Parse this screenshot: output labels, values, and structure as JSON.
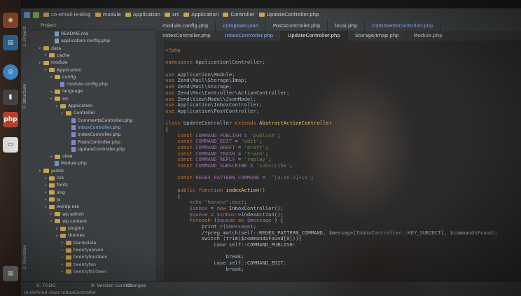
{
  "topbar": {
    "crumbs": [
      "co-email-ie-Blog",
      "module",
      "Application",
      "src",
      "Application",
      "Controller",
      "UpdateController.php"
    ]
  },
  "sidebar_tabs": [
    "1: Project",
    "7: Structure",
    "2: Favorites"
  ],
  "project": {
    "header": "Project",
    "tree": [
      {
        "label": "README.md",
        "indent": 3,
        "kind": "file"
      },
      {
        "label": "application.config.php",
        "indent": 3,
        "kind": "file"
      },
      {
        "label": "data",
        "indent": 1,
        "kind": "folder"
      },
      {
        "label": "cache",
        "indent": 2,
        "kind": "folder"
      },
      {
        "label": "module",
        "indent": 1,
        "kind": "folder"
      },
      {
        "label": "Application",
        "indent": 2,
        "kind": "folder"
      },
      {
        "label": "config",
        "indent": 3,
        "kind": "folder"
      },
      {
        "label": "module.config.php",
        "indent": 4,
        "kind": "php"
      },
      {
        "label": "language",
        "indent": 3,
        "kind": "folder"
      },
      {
        "label": "src",
        "indent": 3,
        "kind": "folder"
      },
      {
        "label": "Application",
        "indent": 4,
        "kind": "folder"
      },
      {
        "label": "Controller",
        "indent": 5,
        "kind": "folder"
      },
      {
        "label": "CommentsController.php",
        "indent": 6,
        "kind": "php"
      },
      {
        "label": "InboxController.php",
        "indent": 6,
        "kind": "php",
        "blue": true
      },
      {
        "label": "IndexController.php",
        "indent": 6,
        "kind": "php"
      },
      {
        "label": "PostsController.php",
        "indent": 6,
        "kind": "php"
      },
      {
        "label": "UpdateController.php",
        "indent": 6,
        "kind": "php"
      },
      {
        "label": "view",
        "indent": 3,
        "kind": "folder"
      },
      {
        "label": "Module.php",
        "indent": 3,
        "kind": "php"
      },
      {
        "label": "public",
        "indent": 1,
        "kind": "folder"
      },
      {
        "label": "css",
        "indent": 2,
        "kind": "folder"
      },
      {
        "label": "fonts",
        "indent": 2,
        "kind": "folder"
      },
      {
        "label": "img",
        "indent": 2,
        "kind": "folder"
      },
      {
        "label": "js",
        "indent": 2,
        "kind": "folder"
      },
      {
        "label": "wordp ess",
        "indent": 2,
        "kind": "folder"
      },
      {
        "label": "wp admin",
        "indent": 3,
        "kind": "folder"
      },
      {
        "label": "wp content",
        "indent": 3,
        "kind": "folder"
      },
      {
        "label": "plugins",
        "indent": 4,
        "kind": "folder"
      },
      {
        "label": "themes",
        "indent": 4,
        "kind": "folder"
      },
      {
        "label": "blankslate",
        "indent": 5,
        "kind": "folder"
      },
      {
        "label": "twentyeleven",
        "indent": 5,
        "kind": "folder"
      },
      {
        "label": "twentyfourteen",
        "indent": 5,
        "kind": "folder"
      },
      {
        "label": "twentyten",
        "indent": 5,
        "kind": "folder"
      },
      {
        "label": "twentythirteen",
        "indent": 5,
        "kind": "folder"
      }
    ]
  },
  "tabs_row1": [
    {
      "label": "module.config.php",
      "state": ""
    },
    {
      "label": "composer.json",
      "state": "blue"
    },
    {
      "label": "PostsController.php",
      "state": ""
    },
    {
      "label": "local.php",
      "state": ""
    },
    {
      "label": "CommentsController.php",
      "state": "blue"
    }
  ],
  "tabs_row2": [
    {
      "label": "IndexController.php",
      "state": ""
    },
    {
      "label": "InboxController.php",
      "state": "blue"
    },
    {
      "label": "UpdateController.php",
      "state": "active"
    },
    {
      "label": "Storage/Imap.php",
      "state": ""
    },
    {
      "label": "Module.php",
      "state": ""
    }
  ],
  "editor": {
    "lines": [
      [
        [
          "kw",
          "<?php"
        ]
      ],
      [
        [
          "",
          ""
        ]
      ],
      [
        [
          "kw",
          "namespace "
        ],
        [
          "",
          "Application\\Controller;"
        ]
      ],
      [
        [
          "",
          ""
        ]
      ],
      [
        [
          "kw",
          "use "
        ],
        [
          "",
          "Application\\Module;"
        ]
      ],
      [
        [
          "kw",
          "use "
        ],
        [
          "",
          "Zend\\Mail\\Storage\\Imap;"
        ]
      ],
      [
        [
          "kw",
          "use "
        ],
        [
          "",
          "Zend\\Mail\\Storage;"
        ]
      ],
      [
        [
          "kw",
          "use "
        ],
        [
          "",
          "Zend\\Mvc\\Controller\\ActionController;"
        ]
      ],
      [
        [
          "kw",
          "use "
        ],
        [
          "",
          "Zend\\View\\Model\\JsonModel;"
        ]
      ],
      [
        [
          "kw",
          "use "
        ],
        [
          "",
          "Application\\InboxController;"
        ]
      ],
      [
        [
          "kw",
          "use "
        ],
        [
          "",
          "Application\\PostController;"
        ]
      ],
      [
        [
          "",
          ""
        ]
      ],
      [
        [
          "kw",
          "class "
        ],
        [
          "",
          "UpdateController "
        ],
        [
          "kw",
          "extends "
        ],
        [
          "cls",
          "AbstractActionController"
        ]
      ],
      [
        [
          "",
          "{"
        ]
      ],
      [
        [
          "kw",
          "    const "
        ],
        [
          "var",
          "COMMAND_PUBLISH"
        ],
        [
          "",
          " = "
        ],
        [
          "str",
          "'publish'"
        ],
        [
          "",
          ";"
        ]
      ],
      [
        [
          "kw",
          "    const "
        ],
        [
          "var",
          "COMMAND_EDIT"
        ],
        [
          "",
          " = "
        ],
        [
          "str",
          "'edit'"
        ],
        [
          "",
          ";"
        ]
      ],
      [
        [
          "kw",
          "    const "
        ],
        [
          "var",
          "COMMAND_DRAFT"
        ],
        [
          "",
          " = "
        ],
        [
          "str",
          "'draft'"
        ],
        [
          "",
          ";"
        ]
      ],
      [
        [
          "kw",
          "    const "
        ],
        [
          "var",
          "COMMAND_TRASH"
        ],
        [
          "",
          " = "
        ],
        [
          "str",
          "'trash'"
        ],
        [
          "",
          ";"
        ]
      ],
      [
        [
          "kw",
          "    const "
        ],
        [
          "var",
          "COMMAND_REPLY"
        ],
        [
          "",
          " = "
        ],
        [
          "str",
          "'replay'"
        ],
        [
          "",
          ";"
        ]
      ],
      [
        [
          "kw",
          "    const "
        ],
        [
          "var",
          "COMMAND_SUBSCRIBE"
        ],
        [
          "",
          " = "
        ],
        [
          "str",
          "'subscribe'"
        ],
        [
          "",
          ";"
        ]
      ],
      [
        [
          "",
          ""
        ]
      ],
      [
        [
          "kw",
          "    const "
        ],
        [
          "var",
          "REGEX_PATTERN_COMMAND"
        ],
        [
          "",
          " = "
        ],
        [
          "str",
          "'^[a-zA-Z]+\\s'"
        ],
        [
          "",
          ";"
        ]
      ],
      [
        [
          "",
          ""
        ]
      ],
      [
        [
          "kw",
          "    public function "
        ],
        [
          "cls",
          "indexAction"
        ],
        [
          "",
          "()"
        ]
      ],
      [
        [
          "",
          "    {"
        ]
      ],
      [
        [
          "kw",
          "        echo "
        ],
        [
          "str",
          "\"banana\""
        ],
        [
          "",
          ";"
        ],
        [
          "kw",
          "exit"
        ],
        [
          "",
          ";"
        ]
      ],
      [
        [
          "var",
          "        $inbox"
        ],
        [
          "",
          " = "
        ],
        [
          "kw",
          "new "
        ],
        [
          "",
          "InboxController();"
        ]
      ],
      [
        [
          "var",
          "        $queue"
        ],
        [
          "",
          " = "
        ],
        [
          "var",
          "$inbox"
        ],
        [
          "",
          "->indexAction();"
        ]
      ],
      [
        [
          "kw",
          "        foreach "
        ],
        [
          "",
          "("
        ],
        [
          "var",
          "$queue"
        ],
        [
          "kw",
          " as "
        ],
        [
          "var",
          "$message"
        ],
        [
          "",
          " ) {"
        ]
      ],
      [
        [
          "",
          "            print_r("
        ],
        [
          "var",
          "$message"
        ],
        [
          "",
          ");"
        ]
      ],
      [
        [
          "",
          "            /*preg_match(self::REGEX_PATTERN_COMMAND, $message[InboxController::KEY_SUBJECT], $commandsFound);"
        ]
      ],
      [
        [
          "",
          "            switch (trim($commandsFound[0])){"
        ]
      ],
      [
        [
          "",
          "                case self::COMMAND_PUBLISH:"
        ]
      ],
      [
        [
          "",
          ""
        ]
      ],
      [
        [
          "",
          "                    break;"
        ]
      ],
      [
        [
          "",
          "                case self::COMMAND_EDIT:"
        ]
      ],
      [
        [
          "",
          "                    break;"
        ]
      ]
    ]
  },
  "statusbar": {
    "todo": "6: TODO",
    "vcs": "9: Version Control",
    "changes": "Changes",
    "message": "Undefined class InboxController"
  }
}
